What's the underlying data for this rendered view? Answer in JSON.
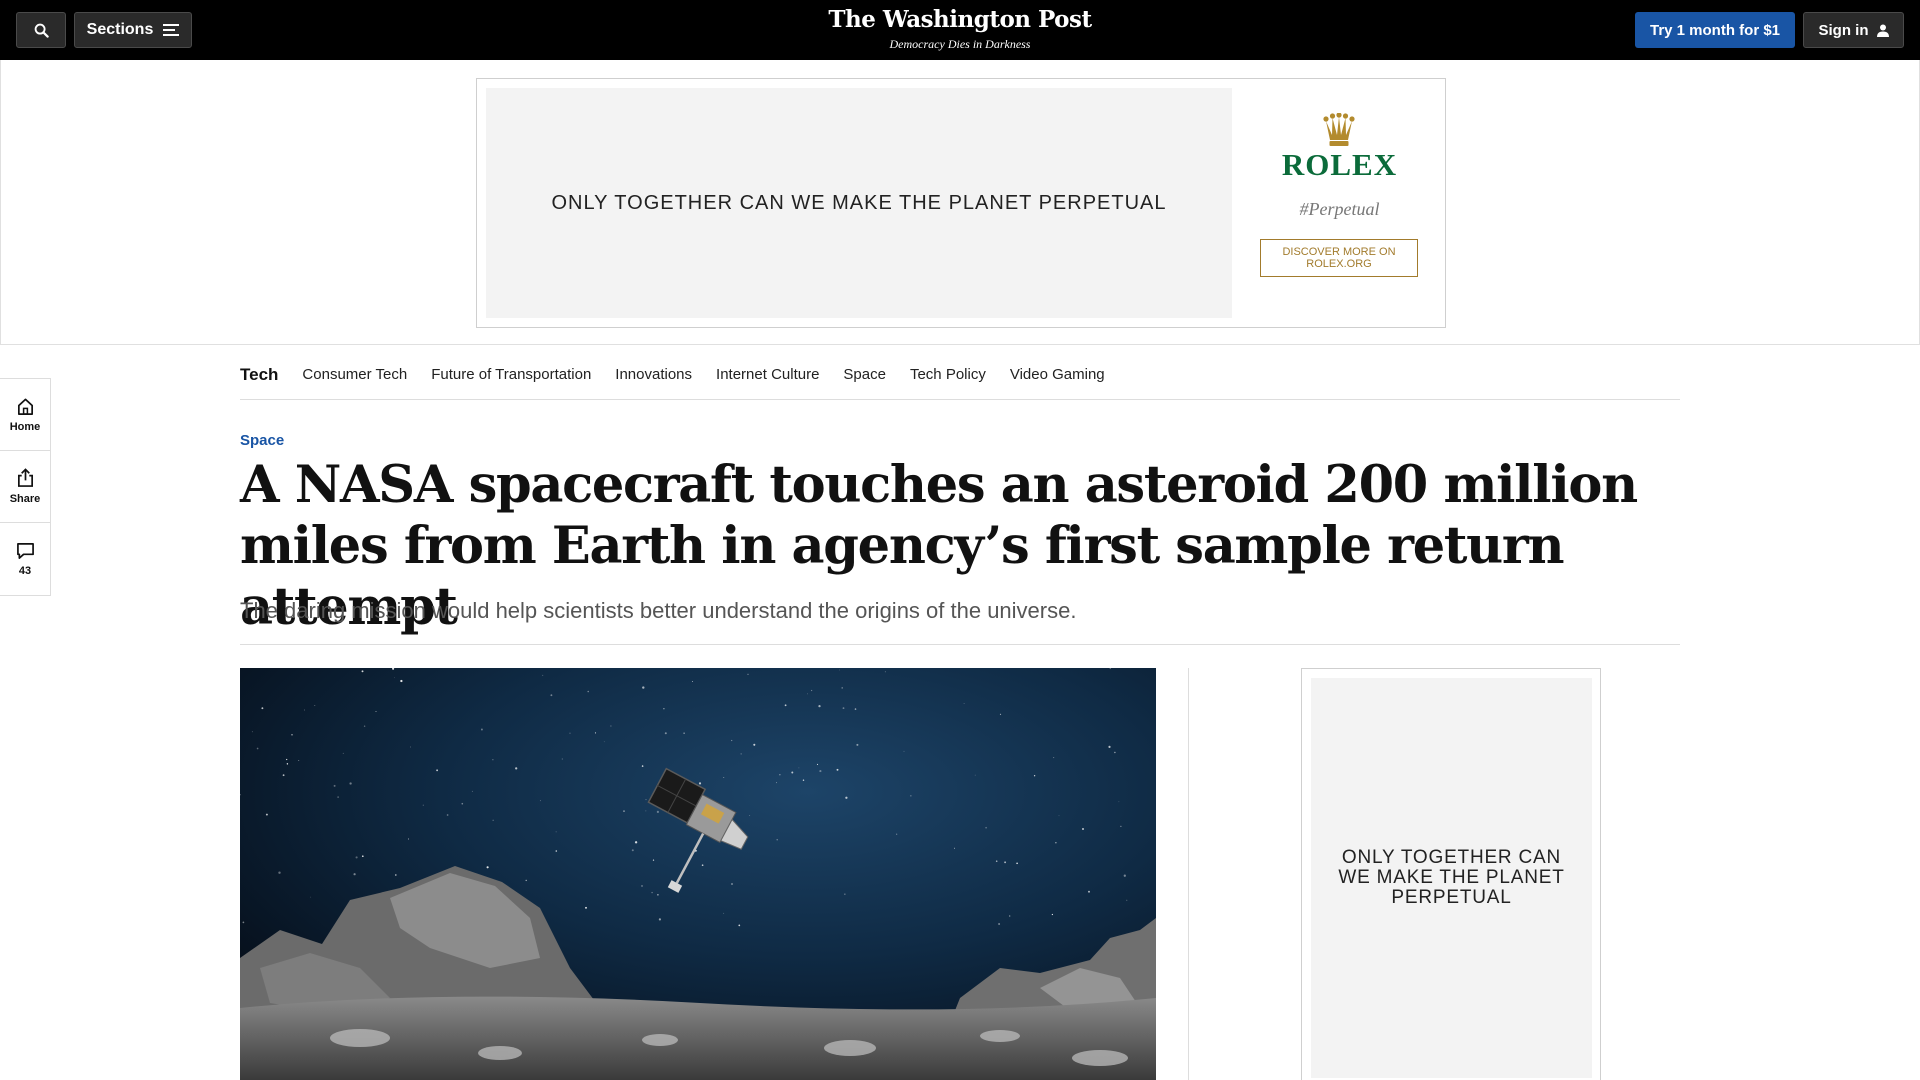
{
  "header": {
    "sections_label": "Sections",
    "logo": "The Washington Post",
    "tagline": "Democracy Dies in Darkness",
    "subscribe_label": "Try 1 month for $1",
    "signin_label": "Sign in"
  },
  "top_ad": {
    "message": "ONLY TOGETHER CAN WE MAKE THE PLANET PERPETUAL",
    "brand": "ROLEX",
    "hashtag": "#Perpetual",
    "cta": "DISCOVER MORE ON ROLEX.ORG",
    "brand_color": "#0b6b3a",
    "accent_color": "#a27b2c"
  },
  "rail": {
    "home_label": "Home",
    "share_label": "Share",
    "comments_count": "43"
  },
  "subnav": {
    "section_title": "Tech",
    "links": [
      "Consumer Tech",
      "Future of Transportation",
      "Innovations",
      "Internet Culture",
      "Space",
      "Tech Policy",
      "Video Gaming"
    ]
  },
  "article": {
    "kicker": "Space",
    "headline": "A NASA spacecraft touches an asteroid 200 million miles from Earth in agency’s first sample return attempt",
    "dek": "The daring mission would help scientists better understand the origins of the universe.",
    "kicker_color": "#1955a5"
  },
  "side_ad": {
    "message": "ONLY TOGETHER CAN WE MAKE THE PLANET PERPETUAL"
  },
  "icons": {
    "search": "search-icon",
    "sections": "hamburger-icon",
    "user": "user-icon",
    "home": "home-icon",
    "share": "share-icon",
    "comments": "comment-icon",
    "crown": "crown-icon"
  }
}
